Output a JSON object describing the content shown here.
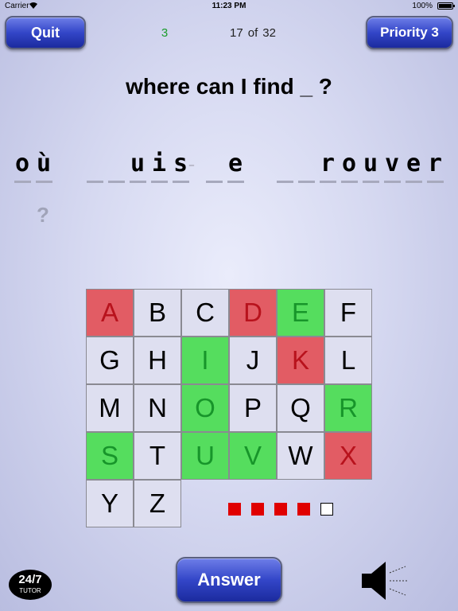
{
  "status_bar": {
    "carrier": "Carrier",
    "time": "11:23 PM",
    "battery": "100%"
  },
  "header": {
    "quit_label": "Quit",
    "score": "3",
    "progress": {
      "current": "17",
      "of": "of",
      "total": "32"
    },
    "priority_label": "Priority 3"
  },
  "prompt": "where can I find _ ?",
  "phrase_slots": [
    "o",
    "ù",
    "",
    "",
    "u",
    "i",
    "s",
    "-",
    "",
    "e",
    "",
    "",
    "r",
    "o",
    "u",
    "v",
    "e",
    "r"
  ],
  "hint": "?",
  "keyboard": {
    "letters": [
      "A",
      "B",
      "C",
      "D",
      "E",
      "F",
      "G",
      "H",
      "I",
      "J",
      "K",
      "L",
      "M",
      "N",
      "O",
      "P",
      "Q",
      "R",
      "S",
      "T",
      "U",
      "V",
      "W",
      "X",
      "Y",
      "Z"
    ],
    "states": [
      "wrong",
      "neutral",
      "neutral",
      "wrong",
      "right",
      "neutral",
      "neutral",
      "neutral",
      "right",
      "neutral",
      "wrong",
      "neutral",
      "neutral",
      "neutral",
      "right",
      "neutral",
      "neutral",
      "right",
      "right",
      "neutral",
      "right",
      "right",
      "neutral",
      "wrong",
      "neutral",
      "neutral"
    ],
    "colors": {
      "neutral": "#dedff0",
      "wrong": "#e25c64",
      "right": "#55dd5e"
    }
  },
  "attempts": {
    "used": 4,
    "total": 5
  },
  "answer_label": "Answer",
  "logo": {
    "line1": "24/7",
    "line2": "TUTOR"
  },
  "icons": {
    "wifi": "wifi-icon",
    "battery": "battery-icon",
    "speaker": "speaker-icon"
  }
}
